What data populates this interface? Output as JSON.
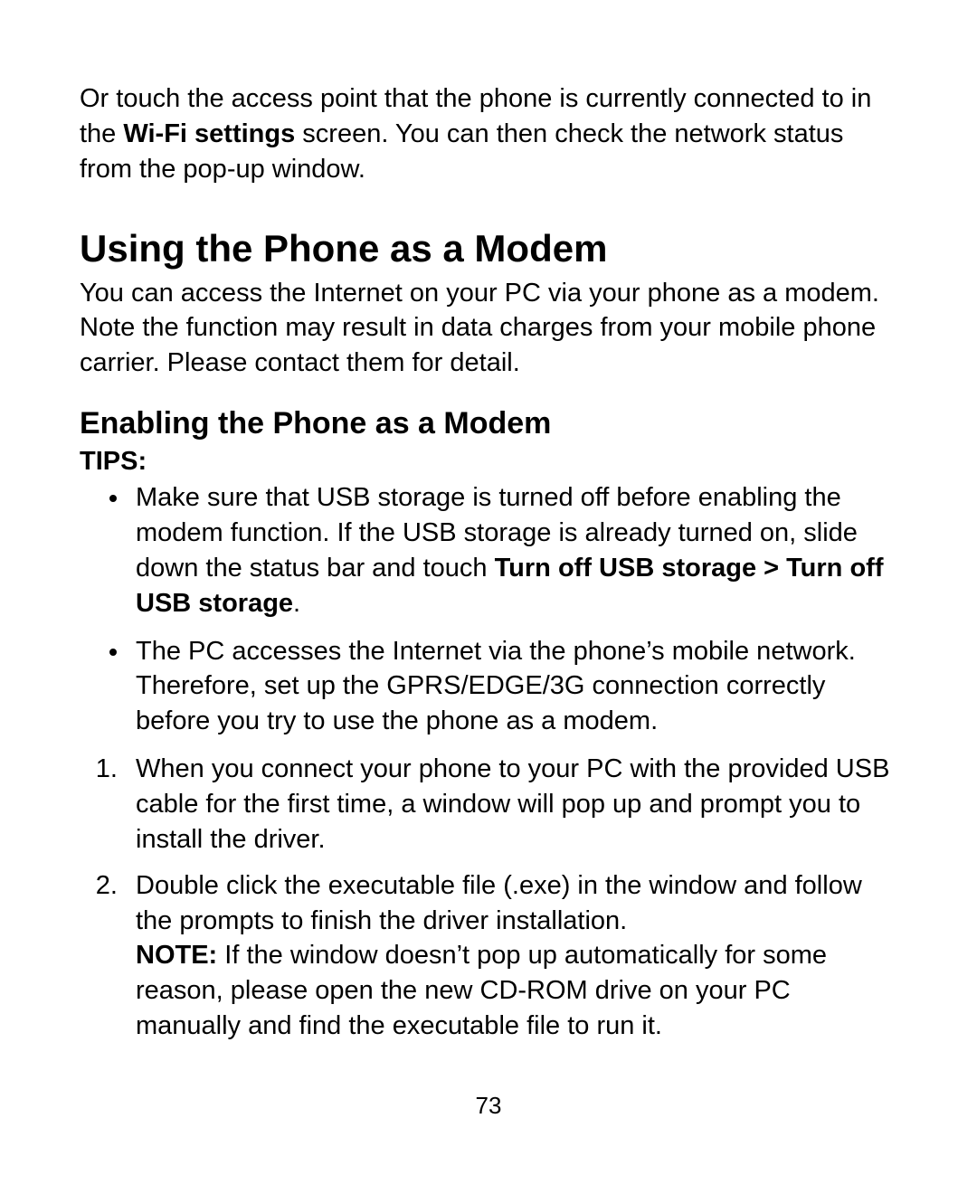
{
  "intro": {
    "t1": "Or touch the access point that the phone is currently connected to in the ",
    "bold": "Wi-Fi settings",
    "t2": " screen. You can then check the network status from the pop-up window."
  },
  "h1": "Using the Phone as a Modem",
  "h1_body": "You can access the Internet on your PC via your phone as a modem. Note the function may result in data charges from your mobile phone carrier. Please contact them for detail.",
  "h2": "Enabling the Phone as a Modem",
  "tips_label": "TIPS:",
  "tips": [
    {
      "t1": "Make sure that USB storage is turned off before enabling the modem function. If the USB storage is already turned on, slide down the status bar and touch ",
      "bold": "Turn off USB storage > Turn off USB storage",
      "t2": "."
    },
    {
      "t1": "The PC accesses the Internet via the phone’s mobile network. Therefore, set up the GPRS/EDGE/3G connection correctly before you try to use the phone as a modem.",
      "bold": "",
      "t2": ""
    }
  ],
  "steps": [
    {
      "body": "When you connect your phone to your PC with the provided USB cable for the first time, a window will pop up and prompt you to install the driver."
    },
    {
      "body": "Double click the executable file (.exe) in the window and follow the prompts to finish the driver installation.",
      "note_label": "NOTE:",
      "note_body": " If the window doesn’t pop up automatically for some reason, please open the new CD-ROM drive on your PC manually and find the executable file to run it."
    }
  ],
  "page_number": "73"
}
